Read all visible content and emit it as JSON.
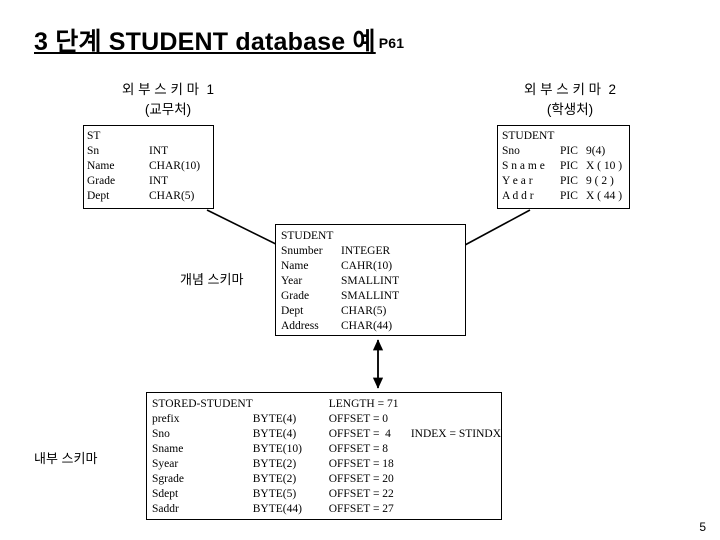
{
  "slide": {
    "title_main": "3 단계 STUDENT database 예",
    "title_sub": "P61",
    "page_number": "5"
  },
  "labels": {
    "external_1": "외 부 스 키 마  1\n(교무처)",
    "external_2": "외 부 스 키 마  2\n(학생처)",
    "conceptual": "개념 스키마",
    "internal": "내부 스키마"
  },
  "external_schema_1": {
    "title": "ST",
    "rows": [
      {
        "name": "Sn",
        "type": "INT"
      },
      {
        "name": "Name",
        "type": "CHAR(10)"
      },
      {
        "name": "Grade",
        "type": "INT"
      },
      {
        "name": "Dept",
        "type": "CHAR(5)"
      }
    ]
  },
  "external_schema_2": {
    "title": "STUDENT",
    "rows": [
      {
        "name": "Sno",
        "kw": "PIC",
        "type": "9(4)"
      },
      {
        "name": "S n a m e",
        "kw": "PIC",
        "type": "X ( 10 )"
      },
      {
        "name": "Y e a r",
        "kw": "PIC",
        "type": "9 ( 2 )"
      },
      {
        "name": "A d d r",
        "kw": "PIC",
        "type": "X ( 44 )"
      }
    ]
  },
  "conceptual_schema": {
    "title": "STUDENT",
    "rows": [
      {
        "name": "Snumber",
        "type": "INTEGER"
      },
      {
        "name": "Name",
        "type": "CAHR(10)"
      },
      {
        "name": "Year",
        "type": "SMALLINT"
      },
      {
        "name": "Grade",
        "type": "SMALLINT"
      },
      {
        "name": "Dept",
        "type": "CHAR(5)"
      },
      {
        "name": "Address",
        "type": "CHAR(44)"
      }
    ]
  },
  "internal_schema": {
    "title": "STORED-STUDENT",
    "title_right": "LENGTH = 71",
    "rows": [
      {
        "name": "prefix",
        "type": "BYTE(4)",
        "offset": "OFFSET = 0",
        "extra": ""
      },
      {
        "name": "Sno",
        "type": "BYTE(4)",
        "offset": "OFFSET =  4",
        "extra": "INDEX = STINDX"
      },
      {
        "name": "Sname",
        "type": "BYTE(10)",
        "offset": "OFFSET = 8",
        "extra": ""
      },
      {
        "name": "Syear",
        "type": "BYTE(2)",
        "offset": "OFFSET = 18",
        "extra": ""
      },
      {
        "name": "Sgrade",
        "type": "BYTE(2)",
        "offset": "OFFSET = 20",
        "extra": ""
      },
      {
        "name": "Sdept",
        "type": "BYTE(5)",
        "offset": "OFFSET = 22",
        "extra": ""
      },
      {
        "name": "Saddr",
        "type": "BYTE(44)",
        "offset": "OFFSET = 27",
        "extra": ""
      }
    ]
  }
}
